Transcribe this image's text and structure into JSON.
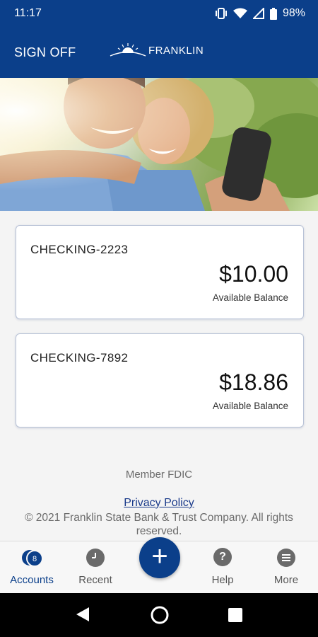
{
  "status_bar": {
    "time": "11:17",
    "battery": "98%"
  },
  "header": {
    "sign_off": "SIGN OFF",
    "logo_text": "FRANKLIN"
  },
  "accounts": [
    {
      "name": "CHECKING-2223",
      "balance": "$10.00",
      "caption": "Available Balance"
    },
    {
      "name": "CHECKING-7892",
      "balance": "$18.86",
      "caption": "Available Balance"
    }
  ],
  "footer": {
    "fdic": "Member FDIC",
    "privacy": "Privacy Policy",
    "copyright": "© 2021 Franklin State Bank & Trust Company. All rights reserved."
  },
  "bottom_nav": {
    "accounts_label": "Accounts",
    "accounts_badge": "8",
    "recent_label": "Recent",
    "add_symbol": "+",
    "help_label": "Help",
    "help_symbol": "?",
    "more_label": "More"
  },
  "colors": {
    "brand": "#0b3f8a",
    "background": "#f4f4f4",
    "card_border": "#b8c2d6"
  },
  "icons": [
    "wifi-icon",
    "signal-icon",
    "battery-icon",
    "vibrate-icon",
    "sun-logo-icon",
    "accounts-icon",
    "recent-clock-icon",
    "add-icon",
    "help-icon",
    "more-icon",
    "back-icon",
    "home-icon",
    "overview-icon"
  ]
}
